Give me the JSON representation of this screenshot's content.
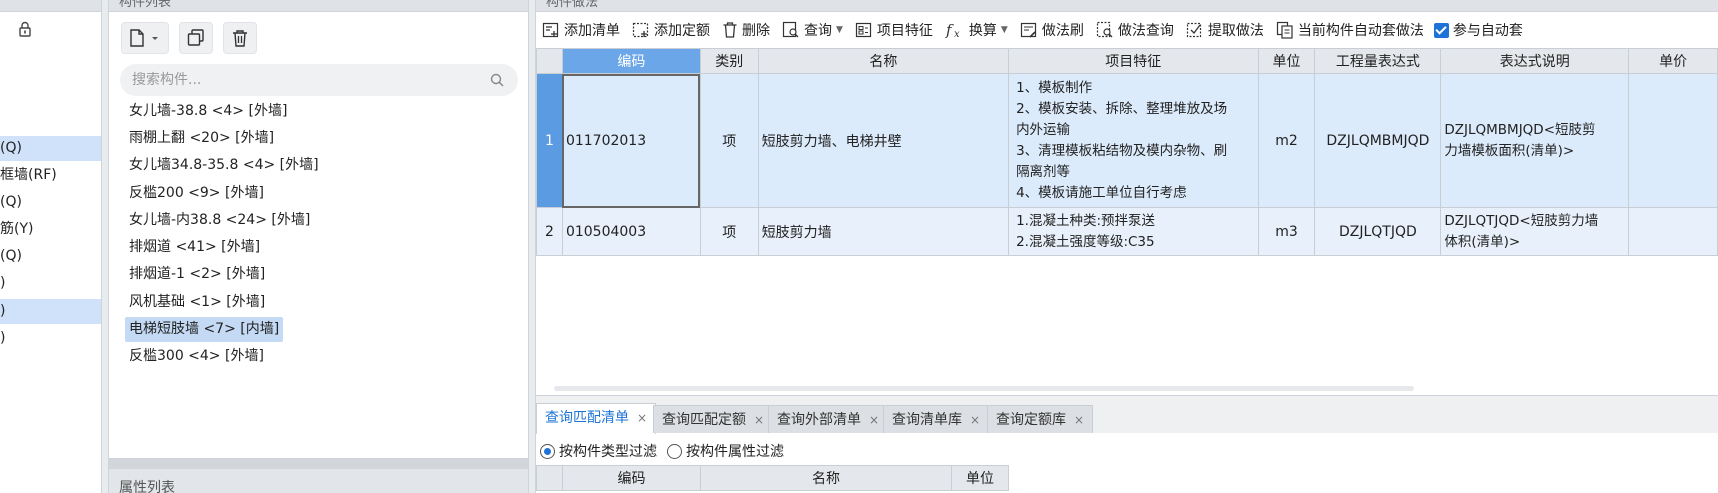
{
  "left_nav": {
    "items": [
      {
        "label": "(Q)",
        "selected": true
      },
      {
        "label": "框墙(RF)",
        "selected": false
      },
      {
        "label": "(Q)",
        "selected": false
      },
      {
        "label": "筋(Y)",
        "selected": false
      },
      {
        "label": "(Q)",
        "selected": false
      },
      {
        "label": ")",
        "selected": false
      },
      {
        "label": ")",
        "selected": true
      },
      {
        "label": ")",
        "selected": false
      }
    ]
  },
  "component_list": {
    "panel_title": "构件列表",
    "search_placeholder": "搜索构件...",
    "items": [
      {
        "label": "女儿墙-38.8 <4> [外墙]",
        "selected": false
      },
      {
        "label": "雨棚上翻 <20> [外墙]",
        "selected": false
      },
      {
        "label": "女儿墙34.8-35.8 <4> [外墙]",
        "selected": false
      },
      {
        "label": "反槛200 <9> [外墙]",
        "selected": false
      },
      {
        "label": "女儿墙-内38.8 <24> [外墙]",
        "selected": false
      },
      {
        "label": "排烟道 <41> [外墙]",
        "selected": false
      },
      {
        "label": "排烟道-1 <2> [外墙]",
        "selected": false
      },
      {
        "label": "风机基础 <1> [外墙]",
        "selected": false
      },
      {
        "label": "电梯短肢墙 <7> [内墙]",
        "selected": true
      },
      {
        "label": "反槛300 <4> [外墙]",
        "selected": false
      }
    ],
    "property_panel_title": "属性列表"
  },
  "method_panel": {
    "panel_title": "构件做法",
    "toolbar": {
      "add_list": "添加清单",
      "add_quota": "添加定额",
      "delete": "删除",
      "query": "查询",
      "item_feature": "项目特征",
      "convert": "换算",
      "method_brush": "做法刷",
      "method_query": "做法查询",
      "extract_method": "提取做法",
      "auto_apply": "当前构件自动套做法",
      "participate_auto": "参与自动套"
    },
    "table": {
      "headers": {
        "code": "编码",
        "category": "类别",
        "name": "名称",
        "feature": "项目特征",
        "unit": "单位",
        "expr": "工程量表达式",
        "expr_desc": "表达式说明",
        "price": "单价"
      },
      "rows": [
        {
          "num": "1",
          "code": "011702013",
          "category": "项",
          "name": "短肢剪力墙、电梯井壁",
          "feature_lines": [
            "1、模板制作",
            "2、模板安装、拆除、整理堆放及场",
            "内外运输",
            "3、清理模板粘结物及模内杂物、刷",
            "隔离剂等",
            "4、模板请施工单位自行考虑"
          ],
          "unit": "m2",
          "expr": "DZJLQMBMJQD",
          "expr_desc_lines": [
            "DZJLQMBMJQD<短肢剪",
            "力墙模板面积(清单)>"
          ],
          "price": ""
        },
        {
          "num": "2",
          "code": "010504003",
          "category": "项",
          "name": "短肢剪力墙",
          "feature_lines": [
            "1.混凝土种类:预拌泵送",
            "2.混凝土强度等级:C35"
          ],
          "unit": "m3",
          "expr": "DZJLQTJQD",
          "expr_desc_lines": [
            "DZJLQTJQD<短肢剪力墙",
            "体积(清单)>"
          ],
          "price": ""
        }
      ]
    },
    "bottom_tabs": [
      {
        "label": "查询匹配清单",
        "active": true
      },
      {
        "label": "查询匹配定额",
        "active": false
      },
      {
        "label": "查询外部清单",
        "active": false
      },
      {
        "label": "查询清单库",
        "active": false
      },
      {
        "label": "查询定额库",
        "active": false
      }
    ],
    "filter": {
      "by_type": "按构件类型过滤",
      "by_attr": "按构件属性过滤",
      "selected": "by_type"
    },
    "bottom_table_headers": {
      "code": "编码",
      "name": "名称",
      "unit": "单位"
    }
  }
}
